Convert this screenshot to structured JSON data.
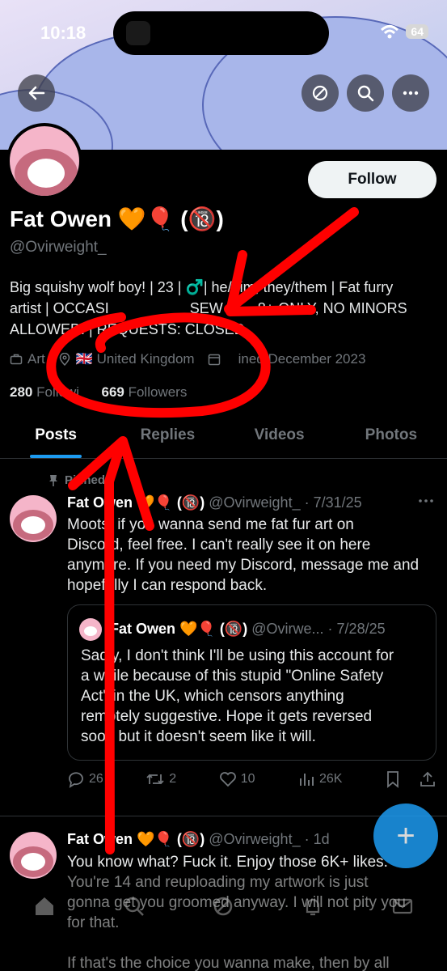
{
  "status_bar": {
    "time": "10:18",
    "battery": "64"
  },
  "header": {
    "back_icon": "arrow-left-icon",
    "repost_icon": "no-sign-icon",
    "search_icon": "search-icon",
    "more_icon": "more-horizontal-icon"
  },
  "profile": {
    "name": "Fat Owen 🧡🎈 (🔞)",
    "handle": "@Ovirweight_",
    "follow_label": "Follow",
    "bio_line1": "Big squishy wolf boy! | 23 | ♂️| he/him, they/them | Fat furry",
    "bio_line2": "artist | OCCASI",
    "bio_line2b": "SEW —",
    "bio_line2c": "8+ ONLY, NO MINORS",
    "bio_line3": "ALLOWE",
    "bio_line3b": "D! | REQUESTS: CLOSE",
    "bio_line3c": "D",
    "category": "Art",
    "category_prefix": "Arti",
    "location": "🇬🇧 United Kingdom",
    "joined": "ined December 2023",
    "following_count": "280",
    "following_label": "Followi",
    "followers_count": "669",
    "followers_label": "Followers"
  },
  "tabs": [
    "Posts",
    "Replies",
    "Videos",
    "Photos"
  ],
  "pinned_label": "Pinned",
  "post1": {
    "name": "Fat Owen 🧡🎈 (🔞)",
    "handle_date": "@Ovirweight_ · 7/31/25",
    "line1": "Moots, if you wanna send me fat fur art on",
    "line2": "Discord, feel free. I can't really see it on here",
    "line3": "anymore. If you need my Discord, message me and",
    "line4": "hopefully I can respond back.",
    "quote": {
      "name": "Fat Owen 🧡🎈 (🔞)",
      "handle_date": "@Ovirwe... · 7/28/25",
      "line1": "Sadly, I don't think I'll be using this account for",
      "line2": "a while because of this stupid \"Online Safety",
      "line3": "Act\" in the UK, which censors anything",
      "line4": "remotely suggestive. Hope it gets reversed",
      "line5": "soon but it doesn't seem like it will."
    },
    "replies": "26",
    "reposts": "2",
    "likes": "10",
    "views": "26K"
  },
  "post2": {
    "name": "Fat Owen 🧡🎈 (🔞)",
    "handle_date": "@Ovirweight_ · 1d",
    "line1": "You know what? Fuck it. Enjoy those 6K+ likes.",
    "line2": "You're 14 and reuploading my artwork is just",
    "line3": "gonna get you groomed anyway. I will not pity you",
    "line4": "for that.",
    "line5": "If that's the choice you wanna make, then by all"
  },
  "colors": {
    "accent": "#1d9bf0",
    "annotation": "#ff0000",
    "muted": "#71767b"
  }
}
